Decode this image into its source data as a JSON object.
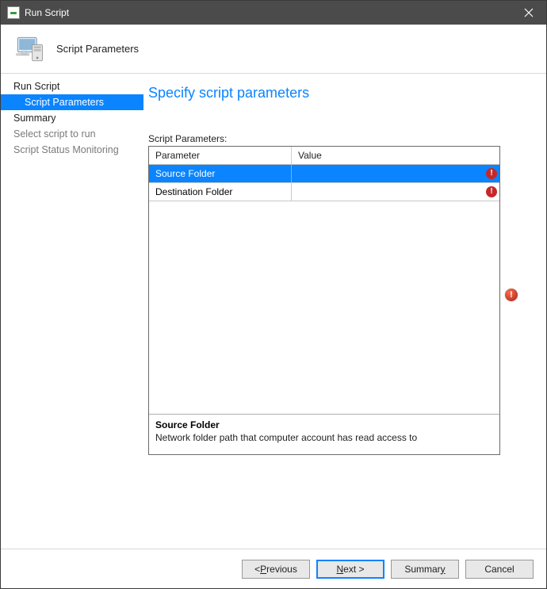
{
  "titlebar": {
    "title": "Run Script"
  },
  "header": {
    "label": "Script Parameters"
  },
  "sidebar": {
    "run_script": "Run Script",
    "script_parameters": "Script Parameters",
    "summary": "Summary",
    "select_script": "Select script to run",
    "status_monitoring": "Script Status Monitoring"
  },
  "main": {
    "title": "Specify script parameters",
    "params_label": "Script Parameters:",
    "columns": {
      "param": "Parameter",
      "value": "Value"
    },
    "rows": [
      {
        "param": "Source Folder",
        "value": "",
        "error": true,
        "selected": true
      },
      {
        "param": "Destination Folder",
        "value": "",
        "error": true,
        "selected": false
      }
    ],
    "desc": {
      "title": "Source Folder",
      "text": "Network folder path that computer account has read access to"
    }
  },
  "footer": {
    "previous_pre": "< ",
    "previous_u": "P",
    "previous_post": "revious",
    "next_u": "N",
    "next_post": "ext >",
    "summary_pre": "Summar",
    "summary_u": "y",
    "cancel": "Cancel"
  }
}
